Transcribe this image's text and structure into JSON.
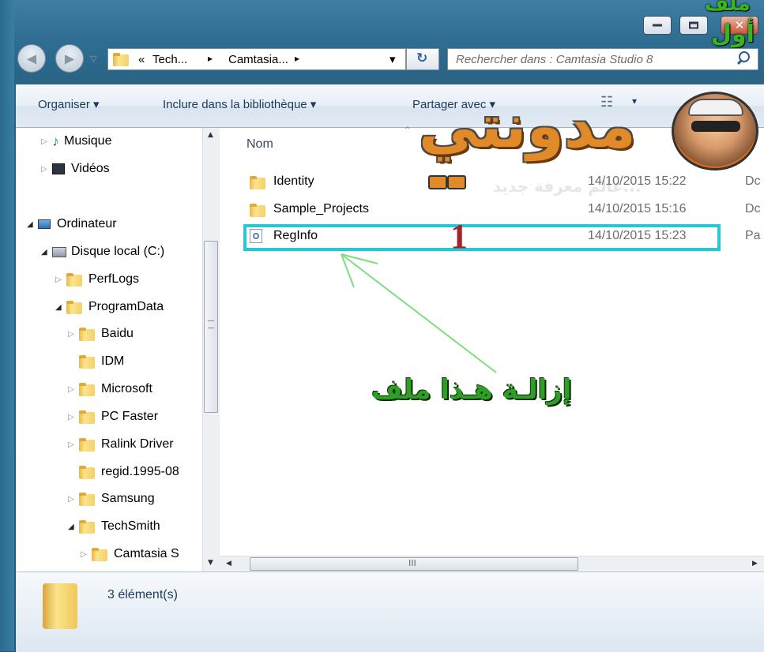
{
  "window": {
    "controls": {
      "minimize": "minimize-icon",
      "maximize": "maximize-icon",
      "close": "close-icon"
    }
  },
  "address": {
    "segments": [
      "«",
      "Tech...",
      "▸",
      "Camtasia...",
      "▸"
    ],
    "dropdown_glyph": "▾",
    "refresh_glyph": "↻"
  },
  "search": {
    "placeholder": "Rechercher dans : Camtasia Studio 8"
  },
  "toolbar": {
    "organize": "Organiser ▾",
    "include": "Inclure dans la bibliothèque ▾",
    "share": "Partager avec ▾"
  },
  "nav": {
    "items": [
      {
        "label": "Musique",
        "icon": "music-icon",
        "expander": "▷"
      },
      {
        "label": "Vidéos",
        "icon": "video-icon",
        "expander": "▷"
      },
      {
        "label": "Ordinateur",
        "icon": "computer-icon",
        "expander": "◢"
      },
      {
        "label": "Disque local (C:)",
        "icon": "drive-icon",
        "expander": "◢"
      },
      {
        "label": "PerfLogs",
        "icon": "folder-icon",
        "expander": "▷"
      },
      {
        "label": "ProgramData",
        "icon": "folder-icon",
        "expander": "◢"
      },
      {
        "label": "Baidu",
        "icon": "folder-icon",
        "expander": "▷"
      },
      {
        "label": "IDM",
        "icon": "folder-icon",
        "expander": ""
      },
      {
        "label": "Microsoft",
        "icon": "folder-icon",
        "expander": "▷"
      },
      {
        "label": "PC Faster",
        "icon": "folder-icon",
        "expander": "▷"
      },
      {
        "label": "Ralink Driver",
        "icon": "folder-icon",
        "expander": "▷"
      },
      {
        "label": "regid.1995-08",
        "icon": "folder-icon",
        "expander": ""
      },
      {
        "label": "Samsung",
        "icon": "folder-icon",
        "expander": "▷"
      },
      {
        "label": "TechSmith",
        "icon": "folder-icon",
        "expander": "◢"
      },
      {
        "label": "Camtasia S",
        "icon": "folder-icon",
        "expander": "▷"
      }
    ]
  },
  "content": {
    "column_name": "Nom",
    "files": [
      {
        "name": "Identity",
        "date": "14/10/2015 15:22",
        "type": "Dc",
        "icon": "folder-icon"
      },
      {
        "name": "Sample_Projects",
        "date": "14/10/2015 15:16",
        "type": "Dc",
        "icon": "folder-icon"
      },
      {
        "name": "RegInfo",
        "date": "14/10/2015 15:23",
        "type": "Pa",
        "icon": "settings-file-icon"
      }
    ],
    "scroll_glyph": "III"
  },
  "annotation": {
    "number": "1",
    "text": "إزالـة هـذا ملف",
    "color_highlight": "#28c7d6",
    "color_text": "#2e9e24",
    "color_number": "#a0242a",
    "color_arrow": "#7be07b"
  },
  "watermark": {
    "logo_text": "مدونتي",
    "sub_text": "عالم معرفة جديد...",
    "corner_top": "ملف",
    "corner_bottom": "أول"
  },
  "status": {
    "count": "3 élément(s)"
  }
}
